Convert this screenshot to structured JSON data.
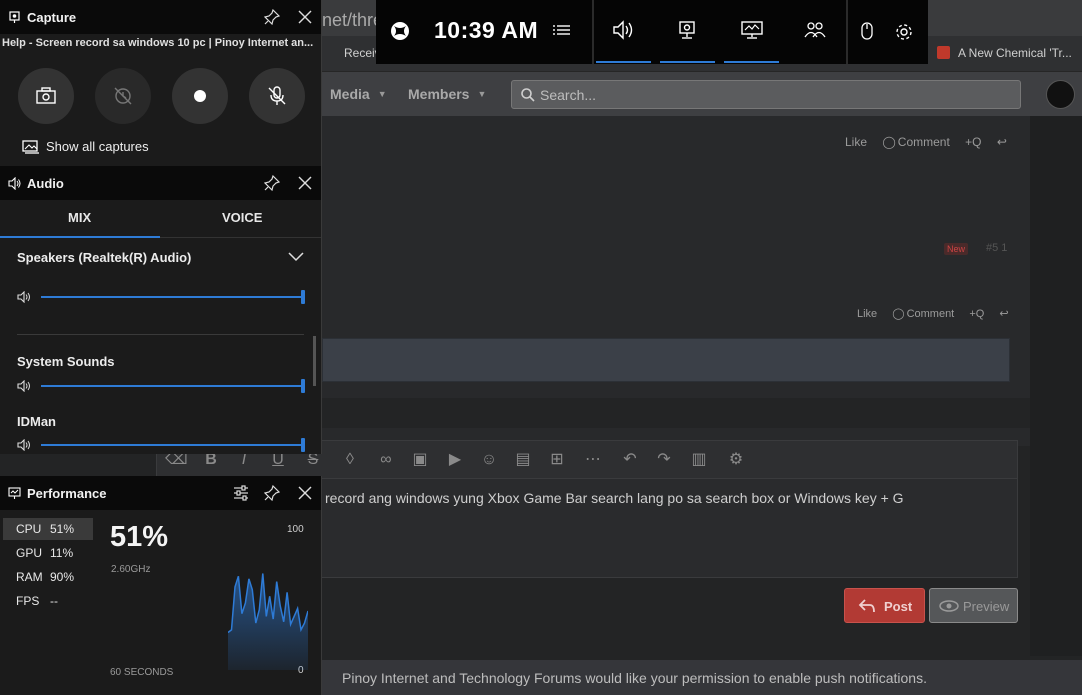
{
  "browser": {
    "url_fragment": "net/thre",
    "bookmarks": [
      "Receiv",
      "A New Chemical 'Tr..."
    ]
  },
  "forum": {
    "nav": [
      {
        "label": "Media"
      },
      {
        "label": "Members"
      }
    ],
    "search_placeholder": "Search...",
    "post_actions_1": {
      "like": "Like",
      "comment": "Comment",
      "quote": "+Q"
    },
    "post_actions_2": {
      "like": "Like",
      "comment": "Comment",
      "quote": "+Q"
    },
    "badge_new": "New",
    "post_number": "#5 1",
    "editor_text": "record ang windows yung Xbox Game Bar search lang po sa search box or Windows key + G",
    "post_button": "Post",
    "preview_button": "Preview",
    "notification": "Pinoy Internet and Technology Forums would like your permission to enable push notifications."
  },
  "gamebar": {
    "time": "10:39 AM"
  },
  "capture": {
    "title": "Capture",
    "window_title": "Help - Screen record sa windows 10 pc | Pinoy Internet an...",
    "show_all": "Show all captures"
  },
  "audio": {
    "title": "Audio",
    "tabs": [
      "MIX",
      "VOICE"
    ],
    "devices": [
      {
        "name": "Speakers (Realtek(R) Audio)",
        "level": 1.0
      },
      {
        "name": "System Sounds",
        "level": 1.0
      },
      {
        "name": "IDMan",
        "level": 1.0
      }
    ]
  },
  "performance": {
    "title": "Performance",
    "metrics": [
      {
        "key": "CPU",
        "value": "51%"
      },
      {
        "key": "GPU",
        "value": "11%"
      },
      {
        "key": "RAM",
        "value": "90%"
      },
      {
        "key": "FPS",
        "value": "--"
      }
    ],
    "big_value": "51%",
    "clock": "2.60GHz",
    "window_label": "60 SECONDS",
    "axis_max": "100",
    "axis_min": "0",
    "cpu_history_percent": [
      28,
      30,
      62,
      70,
      42,
      50,
      68,
      60,
      35,
      45,
      72,
      40,
      55,
      38,
      66,
      48,
      36,
      58,
      34,
      40,
      46,
      30,
      35,
      44
    ]
  },
  "colors": {
    "accent": "#2e7bd6",
    "post_button": "#b23a34",
    "gamebar_bg": "#050505"
  }
}
